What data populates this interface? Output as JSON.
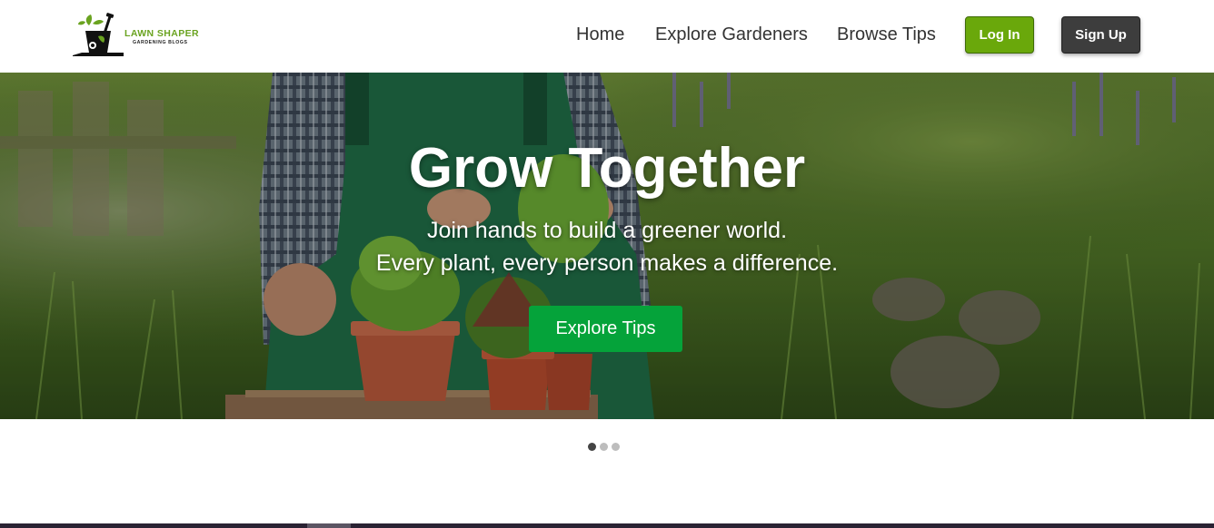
{
  "brand": {
    "name_line1": "LAWN SHAPER",
    "name_line2": "GARDENING BLOGS",
    "logo_icon": "gardener-shovel-icon",
    "accent_color": "#6aa80b"
  },
  "nav": {
    "items": [
      {
        "label": "Home"
      },
      {
        "label": "Explore Gardeners"
      },
      {
        "label": "Browse Tips"
      }
    ],
    "login_label": "Log In",
    "signup_label": "Sign Up",
    "login_color": "#6aa80b",
    "signup_color": "#3d3d3d"
  },
  "hero": {
    "title": "Grow Together",
    "subtitle_line1": "Join hands to build a greener world.",
    "subtitle_line2": "Every plant, every person makes a difference.",
    "cta_label": "Explore Tips",
    "cta_color": "#05a33a",
    "background": "gardener-with-potted-plants-photo"
  },
  "carousel": {
    "slide_count": 3,
    "active_index": 0
  }
}
